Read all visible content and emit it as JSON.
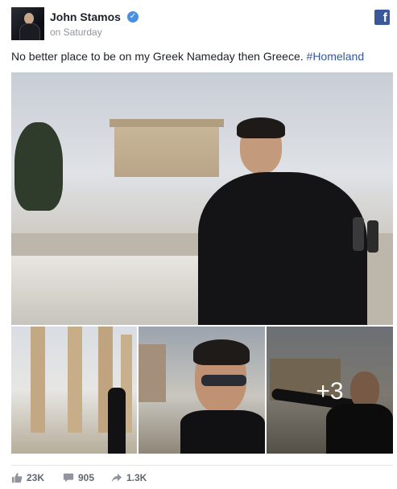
{
  "post": {
    "author": "John Stamos",
    "verified_icon": "check-icon",
    "time": "on Saturday",
    "source_icon": "facebook-logo-icon",
    "source_glyph": "f",
    "caption_text": "No better place to be on my Greek Nameday then Greece. ",
    "hashtag": "#Homeland",
    "colors": {
      "hashtag": "#365899",
      "facebook": "#3b5998",
      "verified": "#4a90e2"
    }
  },
  "photos": {
    "main_alt": "Man in black coat sitting in front of the Parthenon",
    "thumbs": [
      {
        "alt": "Man standing among ancient columns"
      },
      {
        "alt": "Close-up of man wearing sunglasses"
      },
      {
        "alt": "Man with arms outstretched near the Parthenon"
      }
    ],
    "more_count": "+3"
  },
  "stats": {
    "likes": "23K",
    "likes_icon": "thumbs-up-icon",
    "comments": "905",
    "comments_icon": "comment-icon",
    "shares": "1.3K",
    "shares_icon": "share-arrow-icon"
  }
}
